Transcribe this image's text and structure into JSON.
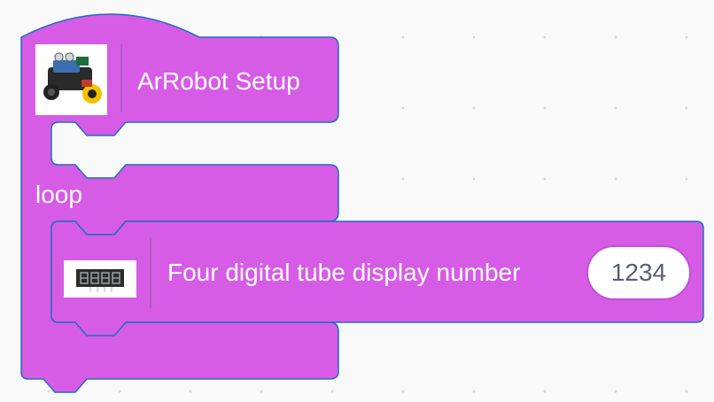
{
  "workspace": {
    "hat_block": {
      "label": "ArRobot Setup",
      "icon": "robot-car-image"
    },
    "loop_block": {
      "label": "loop"
    },
    "display_block": {
      "label": "Four digital tube display number",
      "icon": "four-digit-display-image",
      "value": "1234"
    }
  },
  "colors": {
    "block_fill": "#d65ce6",
    "block_stroke": "#1f6fbf",
    "field_text": "#575e75",
    "canvas_bg": "#f9f9f9"
  }
}
